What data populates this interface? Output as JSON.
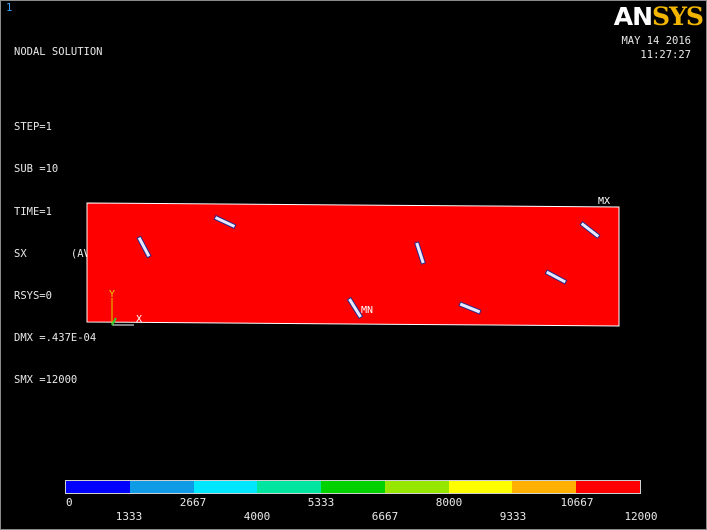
{
  "window_number": "1",
  "logo": {
    "part1": "AN",
    "part2": "SYS"
  },
  "date": "MAY 14 2016",
  "time": "11:27:27",
  "info": [
    "NODAL SOLUTION",
    "",
    "STEP=1",
    "SUB =10",
    "TIME=1",
    "SX       (AVG)",
    "RSYS=0",
    "DMX =.437E-04",
    "SMX =12000"
  ],
  "model": {
    "fill_color": "#ff0000",
    "max_label": "MX",
    "min_label": "MN",
    "axis_y": "Y",
    "axis_x": "X"
  },
  "legend": {
    "colors": [
      "#0000ff",
      "#0f9be6",
      "#00e6ff",
      "#00e6a0",
      "#00d200",
      "#96e600",
      "#ffff00",
      "#ffb000",
      "#ff0000"
    ],
    "labels_upper": [
      "0",
      "2667",
      "5333",
      "8000",
      "10667"
    ],
    "labels_lower": [
      "1333",
      "4000",
      "6667",
      "9333",
      "12000"
    ]
  }
}
